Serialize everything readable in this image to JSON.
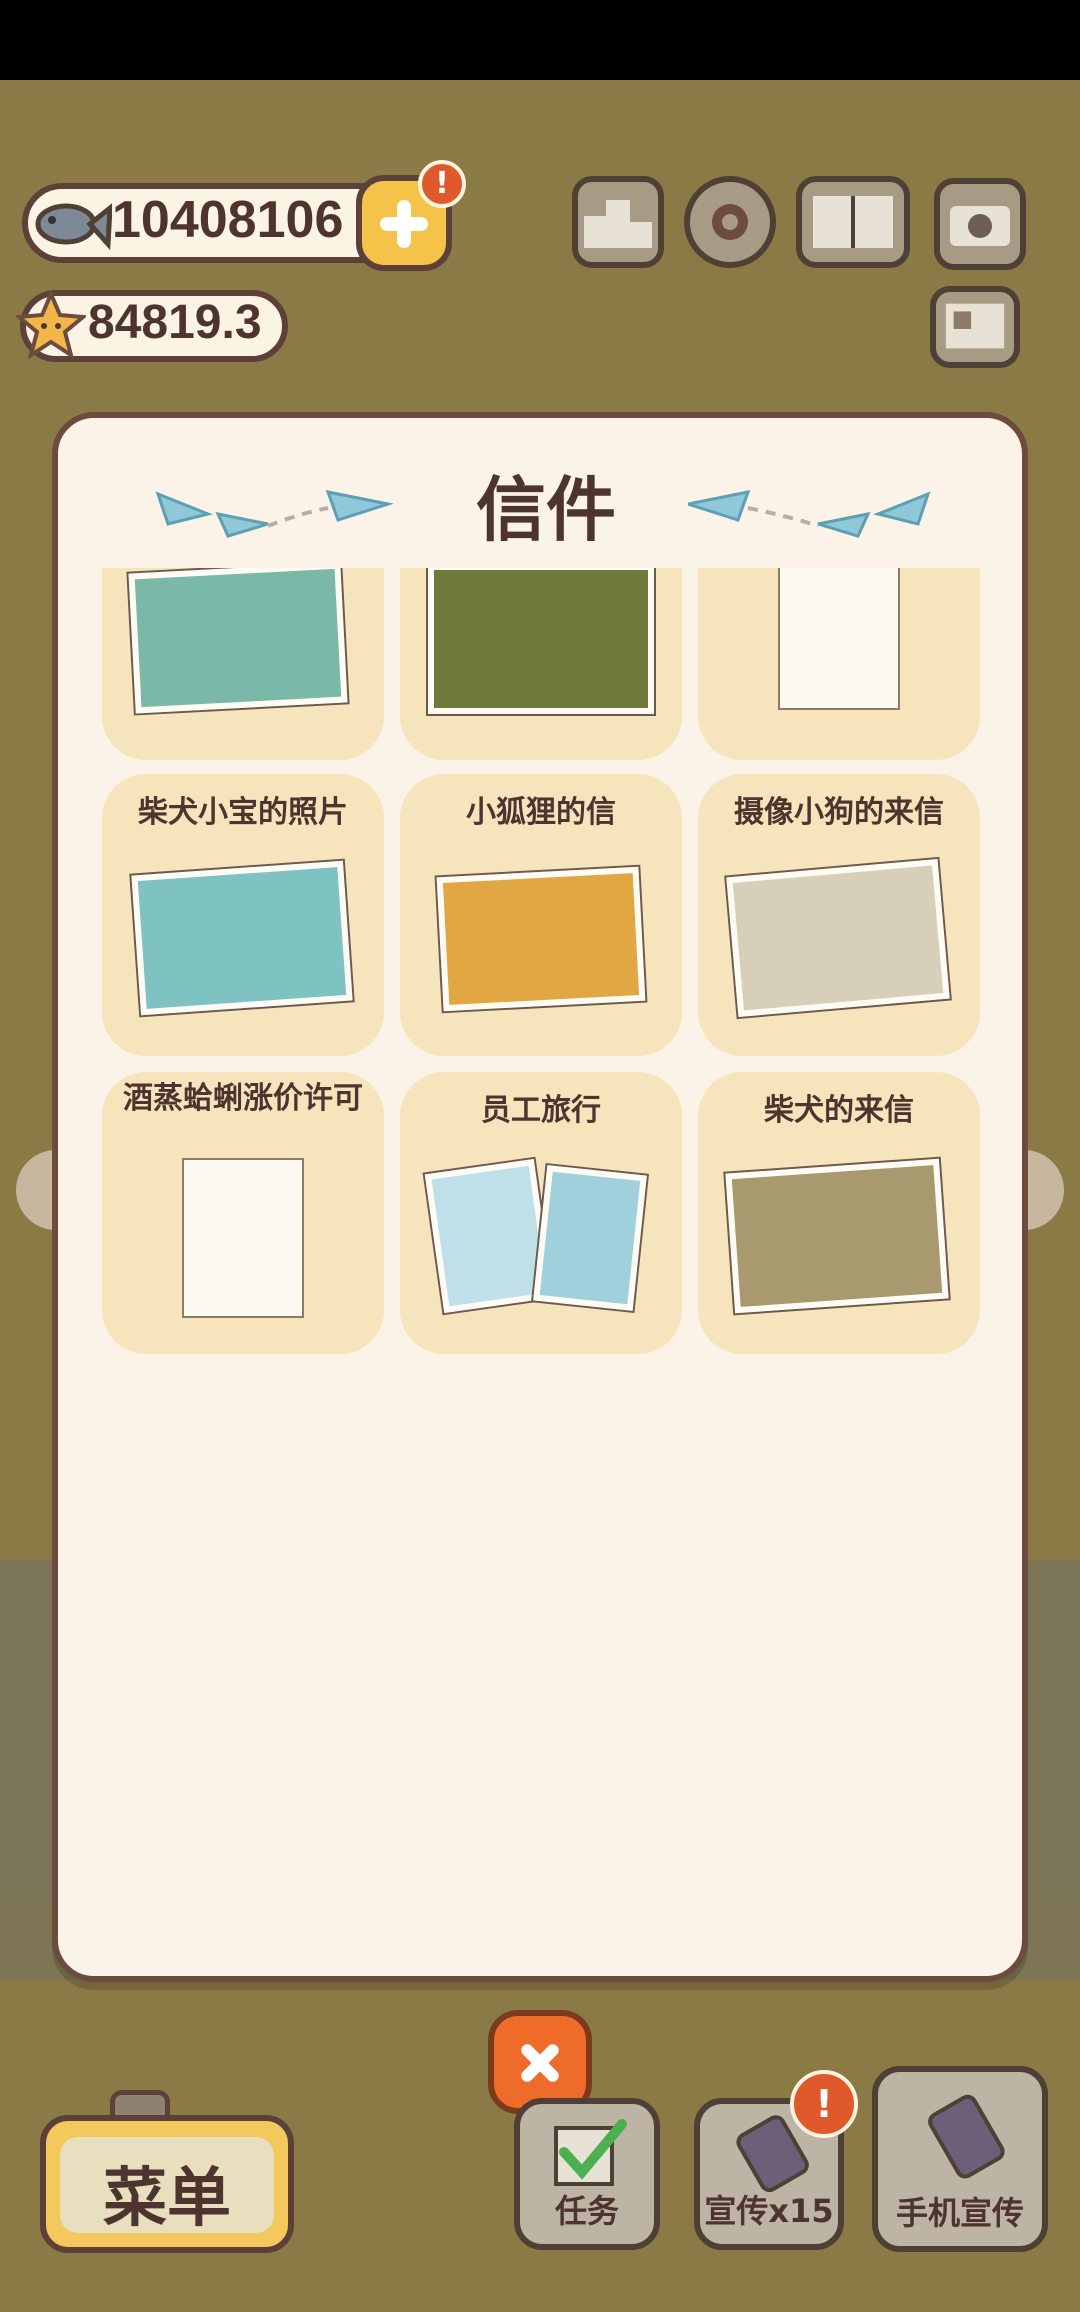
{
  "resources": {
    "fish": "10408106",
    "stars": "84819.3",
    "plus_alert": "!"
  },
  "hud": {
    "ranking_icon": "podium-icon",
    "settings_icon": "gear-icon",
    "album_icon": "paw-book-icon",
    "camera_icon": "camera-icon",
    "news_icon": "newspaper-icon"
  },
  "modal": {
    "title": "信件",
    "letters": [
      {
        "title": "",
        "art": "penguin-float"
      },
      {
        "title": "",
        "art": "alice-cheshire"
      },
      {
        "title": "",
        "art": "letter-paper"
      },
      {
        "title": "柴犬小宝的照片",
        "art": "shiba-blanket"
      },
      {
        "title": "小狐狸的信",
        "art": "fox-field"
      },
      {
        "title": "摄像小狗的来信",
        "art": "camera-dog"
      },
      {
        "title": "酒蒸蛤蜊涨价许可",
        "art": "letter-paper"
      },
      {
        "title": "员工旅行",
        "art": "travel-photos"
      },
      {
        "title": "柴犬的来信",
        "art": "shiba-pair"
      }
    ]
  },
  "bottom": {
    "menu_label": "菜单",
    "task_label": "任务",
    "promo_label": "宣传x15",
    "promo_alert": "!",
    "phone_label": "手机宣传"
  },
  "colors": {
    "panel": "#fbf3e8",
    "card": "#f6e4bd",
    "text": "#4e342e",
    "accent_orange": "#ee6b2a",
    "gold": "#f3c95e"
  }
}
